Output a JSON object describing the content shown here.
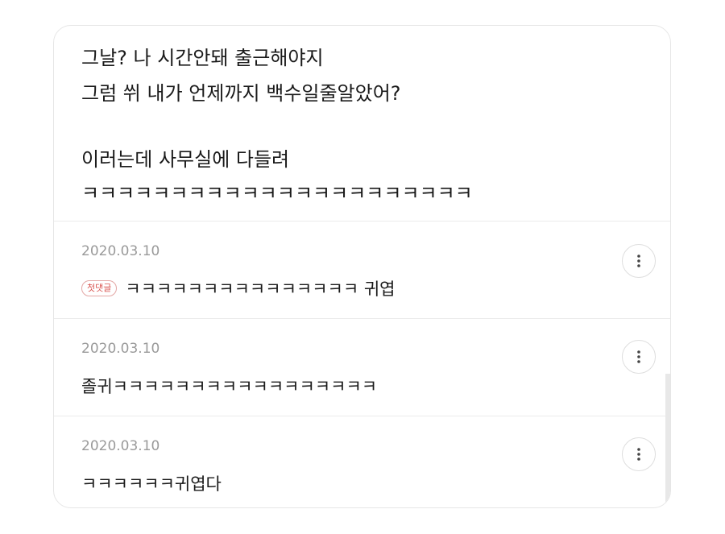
{
  "post": {
    "lines": [
      "그날? 나 시간안돼 출근해야지",
      "그럼 쒸 내가 언제까지 백수일줄알았어?",
      "이러는데 사무실에 다들려",
      "ㅋㅋㅋㅋㅋㅋㅋㅋㅋㅋㅋㅋㅋㅋㅋㅋㅋㅋㅋㅋㅋㅋ"
    ]
  },
  "comments": [
    {
      "date": "2020.03.10",
      "badge": "첫댓글",
      "text": "ㅋㅋㅋㅋㅋㅋㅋㅋㅋㅋㅋㅋㅋㅋㅋ 귀엽"
    },
    {
      "date": "2020.03.10",
      "text": "졸귀ㅋㅋㅋㅋㅋㅋㅋㅋㅋㅋㅋㅋㅋㅋㅋㅋㅋ"
    },
    {
      "date": "2020.03.10",
      "text": "ㅋㅋㅋㅋㅋㅋ귀엽다"
    }
  ],
  "icons": {
    "more": "more-vertical-icon"
  },
  "colors": {
    "badge": "#d9534f",
    "date": "#9a9a9a",
    "text": "#1a1a1a"
  }
}
